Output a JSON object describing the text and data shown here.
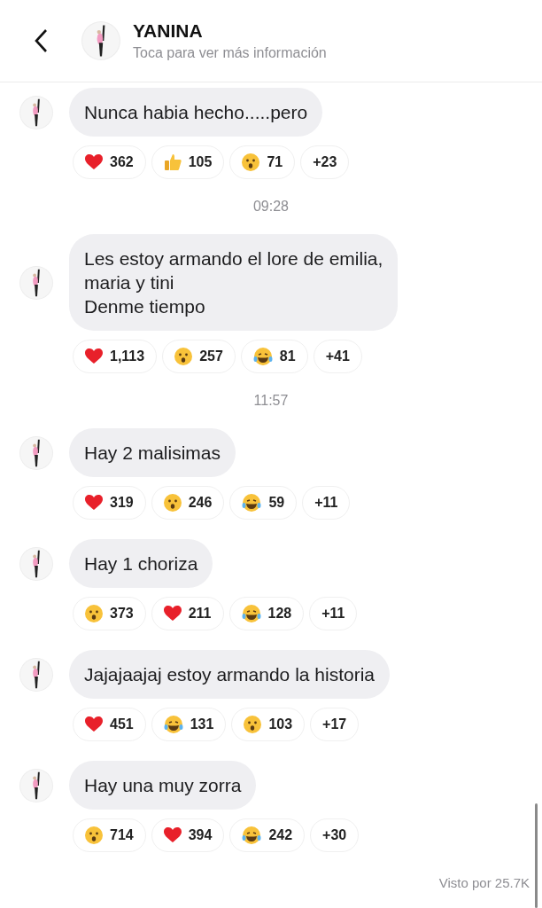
{
  "header": {
    "name": "YANINA",
    "subtitle": "Toca para ver más información"
  },
  "messages": [
    {
      "kind": "message",
      "text": "Nunca habia hecho.....pero",
      "reactions": [
        {
          "kind": "heart",
          "count": "362"
        },
        {
          "kind": "thumbs",
          "count": "105"
        },
        {
          "kind": "wow",
          "count": "71"
        },
        {
          "kind": "more",
          "count": "+23"
        }
      ]
    },
    {
      "kind": "time",
      "text": "09:28"
    },
    {
      "kind": "message",
      "text": "Les estoy armando el lore de emilia,\nmaria y tini\nDenme tiempo",
      "reactions": [
        {
          "kind": "heart",
          "count": "1,113"
        },
        {
          "kind": "wow",
          "count": "257"
        },
        {
          "kind": "laugh",
          "count": "81"
        },
        {
          "kind": "more",
          "count": "+41"
        }
      ]
    },
    {
      "kind": "time",
      "text": "11:57"
    },
    {
      "kind": "message",
      "text": "Hay 2 malisimas",
      "reactions": [
        {
          "kind": "heart",
          "count": "319"
        },
        {
          "kind": "wow",
          "count": "246"
        },
        {
          "kind": "laugh",
          "count": "59"
        },
        {
          "kind": "more",
          "count": "+11"
        }
      ]
    },
    {
      "kind": "message",
      "text": "Hay 1 choriza",
      "reactions": [
        {
          "kind": "wow",
          "count": "373"
        },
        {
          "kind": "heart",
          "count": "211"
        },
        {
          "kind": "laugh",
          "count": "128"
        },
        {
          "kind": "more",
          "count": "+11"
        }
      ]
    },
    {
      "kind": "message",
      "text": "Jajajaajaj estoy armando la historia",
      "reactions": [
        {
          "kind": "heart",
          "count": "451"
        },
        {
          "kind": "laugh",
          "count": "131"
        },
        {
          "kind": "wow",
          "count": "103"
        },
        {
          "kind": "more",
          "count": "+17"
        }
      ]
    },
    {
      "kind": "message",
      "text": "Hay una muy zorra",
      "reactions": [
        {
          "kind": "wow",
          "count": "714"
        },
        {
          "kind": "heart",
          "count": "394"
        },
        {
          "kind": "laugh",
          "count": "242"
        },
        {
          "kind": "more",
          "count": "+30"
        }
      ]
    }
  ],
  "seen": "Visto por 25.7K"
}
